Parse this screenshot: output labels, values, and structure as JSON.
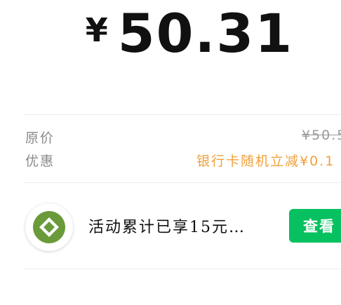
{
  "payment": {
    "currency_symbol": "¥",
    "amount": "50.31"
  },
  "details": {
    "original_label": "原价",
    "original_value": "¥50.5",
    "discount_label": "优惠",
    "discount_value": "银行卡随机立减¥0.1"
  },
  "activity": {
    "logo_icon": "bank-logo-icon",
    "logo_color": "#6a9a3a",
    "text": "活动累计已享15元…",
    "button_label": "查看"
  },
  "colors": {
    "button_bg": "#07c160",
    "discount_text": "#f0a03a",
    "label_text": "#8a8a8a"
  }
}
